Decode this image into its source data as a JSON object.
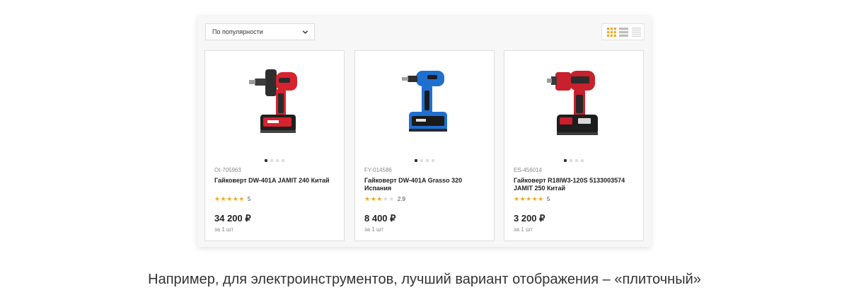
{
  "sort": {
    "label": "По популярности"
  },
  "views": {
    "active": "grid",
    "items": [
      "grid",
      "list",
      "compact"
    ]
  },
  "accent_color": "#f5a623",
  "products": [
    {
      "sku": "OI-705963",
      "title": "Гайковерт DW-401A JAMIT 240 Китай",
      "rating": 5,
      "rating_label": "5",
      "price": "34 200 ₽",
      "unit": "за 1 шт",
      "color": "#d6232f",
      "slide": 1,
      "slides": 4
    },
    {
      "sku": "FY-014586",
      "title": "Гайковерт DW-401A Grasso 320 Испания",
      "rating": 2.9,
      "rating_label": "2.9",
      "price": "8 400 ₽",
      "unit": "за 1 шт",
      "color": "#1f6fd1",
      "slide": 1,
      "slides": 4
    },
    {
      "sku": "ES-456014",
      "title": "Гайковерт R18IW3-120S 5133003574 JAMIT 250 Китай",
      "rating": 5,
      "rating_label": "5",
      "price": "3 200 ₽",
      "unit": "за 1 шт",
      "color": "#c8202c",
      "slide": 1,
      "slides": 4
    }
  ],
  "caption": "Например, для электроинструментов, лучший вариант отображения – «плиточный»"
}
